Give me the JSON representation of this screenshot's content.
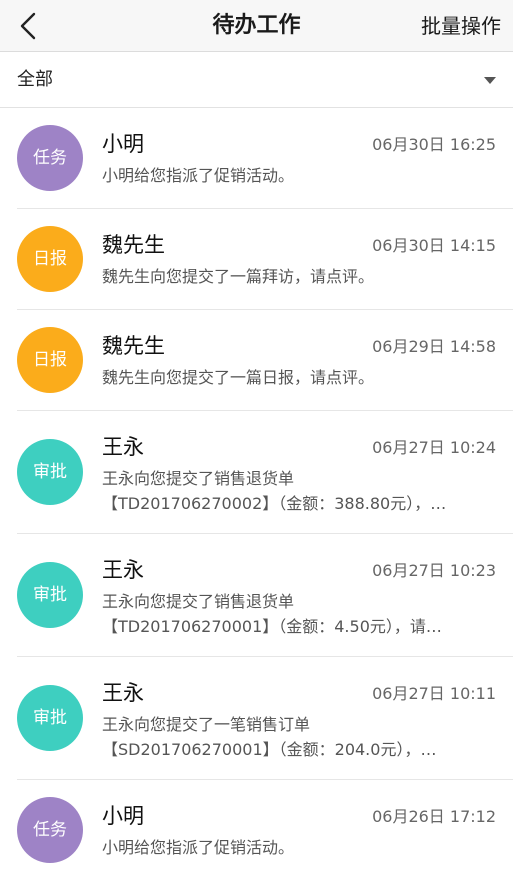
{
  "header": {
    "title": "待办工作",
    "action": "批量操作",
    "back_icon": "chevron-left-icon"
  },
  "filter": {
    "label": "全部",
    "icon": "caret-down-icon"
  },
  "colors": {
    "task": "#9e83c6",
    "report": "#fbac1b",
    "approval": "#3ecfc0"
  },
  "items": [
    {
      "badge": "任务",
      "name": "小明",
      "time": "06月30日 16:25",
      "line1": "小明给您指派了促销活动。",
      "line2": ""
    },
    {
      "badge": "日报",
      "name": "魏先生",
      "time": "06月30日 14:15",
      "line1": "魏先生向您提交了一篇拜访，请点评。",
      "line2": ""
    },
    {
      "badge": "日报",
      "name": "魏先生",
      "time": "06月29日 14:58",
      "line1": "魏先生向您提交了一篇日报，请点评。",
      "line2": ""
    },
    {
      "badge": "审批",
      "name": "王永",
      "time": "06月27日 10:24",
      "line1": "王永向您提交了销售退货单",
      "line2": "【TD201706270002】（金额：388.80元），…"
    },
    {
      "badge": "审批",
      "name": "王永",
      "time": "06月27日 10:23",
      "line1": "王永向您提交了销售退货单",
      "line2": "【TD201706270001】（金额：4.50元），请…"
    },
    {
      "badge": "审批",
      "name": "王永",
      "time": "06月27日 10:11",
      "line1": "王永向您提交了一笔销售订单",
      "line2": "【SD201706270001】（金额：204.0元），…"
    },
    {
      "badge": "任务",
      "name": "小明",
      "time": "06月26日 17:12",
      "line1": "小明给您指派了促销活动。",
      "line2": ""
    }
  ]
}
